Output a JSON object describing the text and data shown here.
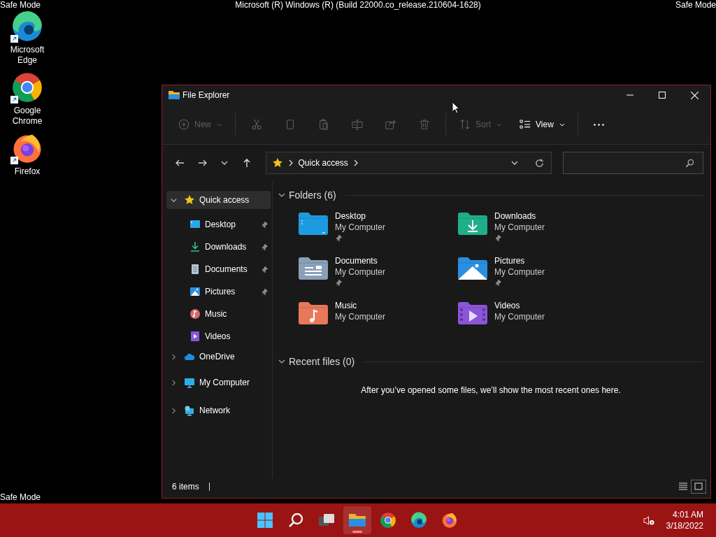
{
  "desktop": {
    "build_text": "Microsoft (R) Windows (R) (Build 22000.co_release.210604-1628)",
    "mode_labels": [
      "Safe Mode",
      "Safe Mode",
      "Safe Mode"
    ],
    "icons": [
      {
        "label": "Microsoft Edge",
        "kind": "edge"
      },
      {
        "label": "Google Chrome",
        "kind": "chrome"
      },
      {
        "label": "Firefox",
        "kind": "firefox"
      }
    ]
  },
  "window": {
    "title": "File Explorer",
    "toolbar_groups": [
      {
        "items": [
          {
            "kind": "new",
            "label": "New",
            "disabled": true,
            "dropdown": true
          }
        ]
      },
      {
        "items": [
          {
            "kind": "cut",
            "disabled": true
          },
          {
            "kind": "copy",
            "disabled": true
          },
          {
            "kind": "paste",
            "disabled": true
          },
          {
            "kind": "rename",
            "disabled": true
          },
          {
            "kind": "share",
            "disabled": true
          },
          {
            "kind": "delete",
            "disabled": true
          }
        ]
      },
      {
        "items": [
          {
            "kind": "sort",
            "label": "Sort",
            "disabled": true,
            "dropdown": true
          },
          {
            "kind": "view",
            "label": "View",
            "disabled": false,
            "dropdown": true
          }
        ]
      },
      {
        "items": [
          {
            "kind": "more",
            "disabled": false
          }
        ]
      }
    ],
    "address": {
      "path": [
        "Quick access"
      ]
    },
    "navigation": [
      {
        "label": "Quick access",
        "kind": "star",
        "expanded": true,
        "selected": true,
        "children": [
          {
            "label": "Desktop",
            "kind": "desktop",
            "pinned": true,
            "selected": false
          },
          {
            "label": "Downloads",
            "kind": "downloads",
            "pinned": true,
            "selected": false
          },
          {
            "label": "Documents",
            "kind": "documents",
            "pinned": true,
            "selected": false
          },
          {
            "label": "Pictures",
            "kind": "pictures",
            "pinned": true,
            "selected": false
          },
          {
            "label": "Music",
            "kind": "music",
            "pinned": false,
            "selected": false
          },
          {
            "label": "Videos",
            "kind": "videos",
            "pinned": false,
            "selected": false
          }
        ]
      },
      {
        "label": "OneDrive",
        "kind": "onedrive",
        "expanded": false,
        "selected": false
      },
      {
        "label": "My Computer",
        "kind": "computer",
        "expanded": false,
        "selected": false
      },
      {
        "label": "Network",
        "kind": "network",
        "expanded": false,
        "selected": false
      }
    ],
    "folders": {
      "title": "Folders (6)",
      "expanded": true,
      "items": [
        {
          "name": "Desktop",
          "location": "My Computer",
          "kind": "desktop",
          "pinned": true
        },
        {
          "name": "Downloads",
          "location": "My Computer",
          "kind": "downloads",
          "pinned": true
        },
        {
          "name": "Documents",
          "location": "My Computer",
          "kind": "documents",
          "pinned": true
        },
        {
          "name": "Pictures",
          "location": "My Computer",
          "kind": "pictures",
          "pinned": true
        },
        {
          "name": "Music",
          "location": "My Computer",
          "kind": "music",
          "pinned": false
        },
        {
          "name": "Videos",
          "location": "My Computer",
          "kind": "videos",
          "pinned": false
        }
      ]
    },
    "recent": {
      "title": "Recent files (0)",
      "expanded": true,
      "message": "After you’ve opened some files, we’ll show the most recent ones here."
    },
    "status": {
      "count": "6 items",
      "views": [
        {
          "kind": "details",
          "selected": false
        },
        {
          "kind": "tiles",
          "selected": true
        }
      ]
    }
  },
  "taskbar": {
    "apps": [
      {
        "kind": "start",
        "active": false
      },
      {
        "kind": "search",
        "active": false
      },
      {
        "kind": "taskview",
        "active": false
      },
      {
        "kind": "explorer",
        "active": true
      },
      {
        "kind": "chrome",
        "active": false
      },
      {
        "kind": "edge",
        "active": false
      },
      {
        "kind": "firefox",
        "active": false
      }
    ],
    "time": "4:01 AM",
    "date": "3/18/2022"
  }
}
